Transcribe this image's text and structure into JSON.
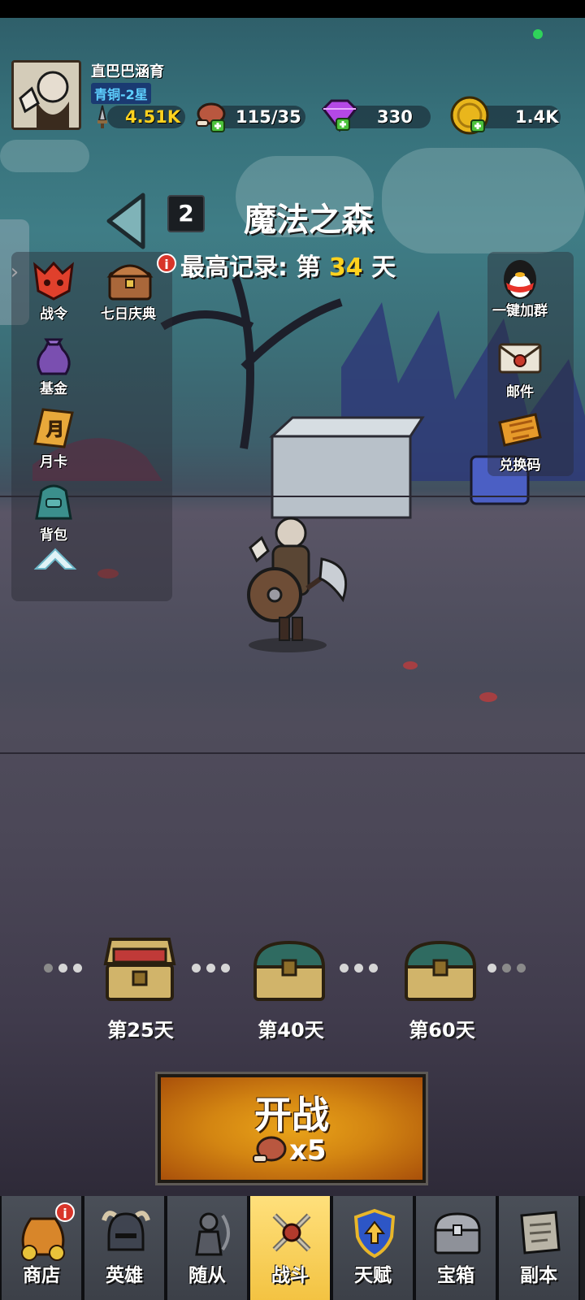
{
  "player": {
    "name": "直巴巴涵育",
    "rank": "青铜-2星"
  },
  "resources": {
    "power": "4.51K",
    "meat": "115/35",
    "gems": "330",
    "gold": "1.4K"
  },
  "stage": {
    "number": "2",
    "title": "魔法之森",
    "record_prefix": "最高记录: 第",
    "record_day": "34",
    "record_suffix": "天"
  },
  "left_menu": [
    {
      "label": "战令",
      "icon": "battle-pass-icon"
    },
    {
      "label": "七日庆典",
      "icon": "seven-day-chest-icon",
      "badge": "i"
    },
    {
      "label": "基金",
      "icon": "fund-bag-icon"
    },
    {
      "label": "月卡",
      "icon": "monthly-card-icon",
      "card_text": "月"
    },
    {
      "label": "背包",
      "icon": "backpack-icon"
    }
  ],
  "right_menu": [
    {
      "label": "一键加群",
      "icon": "qq-penguin-icon"
    },
    {
      "label": "邮件",
      "icon": "mail-icon"
    },
    {
      "label": "兑换码",
      "icon": "redeem-ticket-icon"
    }
  ],
  "side_tab": {
    "icon": "chevron-right-icon",
    "glyph": "›"
  },
  "collapse": {
    "icon": "chevron-up-icon"
  },
  "chests": [
    {
      "label": "第25天",
      "state": "opened"
    },
    {
      "label": "第40天",
      "state": "closed"
    },
    {
      "label": "第60天",
      "state": "closed"
    }
  ],
  "battle": {
    "label": "开战",
    "cost": "x5",
    "cost_icon": "meat-icon"
  },
  "bottom_nav": [
    {
      "label": "商店",
      "icon": "shop-bag-icon",
      "badge": "i",
      "active": false
    },
    {
      "label": "英雄",
      "icon": "hero-helmet-icon",
      "active": false
    },
    {
      "label": "随从",
      "icon": "follower-icon",
      "active": false
    },
    {
      "label": "战斗",
      "icon": "crossed-swords-icon",
      "active": true
    },
    {
      "label": "天赋",
      "icon": "talent-shield-icon",
      "active": false
    },
    {
      "label": "宝箱",
      "icon": "treasure-chest-icon",
      "active": false
    },
    {
      "label": "副本",
      "icon": "dungeon-scroll-icon",
      "active": false
    }
  ],
  "colors": {
    "accent_yellow": "#ffd21e",
    "rank_blue": "#5ed0ff",
    "battle_orange": "#d38512",
    "active_tab": "#f3c342",
    "badge_red": "#d8352a"
  }
}
